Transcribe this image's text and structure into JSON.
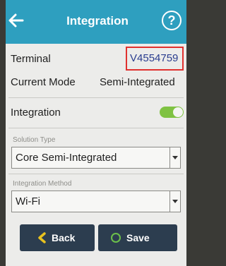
{
  "header": {
    "title": "Integration",
    "back_icon": "arrow-left-icon",
    "help_label": "?"
  },
  "info": {
    "terminal_label": "Terminal",
    "terminal_value": "V4554759",
    "mode_label": "Current Mode",
    "mode_value": "Semi-Integrated",
    "integration_label": "Integration",
    "integration_enabled": true
  },
  "form": {
    "solution_type_label": "Solution Type",
    "solution_type_value": "Core Semi-Integrated",
    "integration_method_label": "Integration Method",
    "integration_method_value": "Wi-Fi"
  },
  "actions": {
    "back_label": "Back",
    "save_label": "Save",
    "back_icon": "chevron-left-icon",
    "save_icon": "circle-icon"
  },
  "colors": {
    "header": "#2e9fbf",
    "toggle_on": "#7fc242",
    "button_bg": "#2c3d4f",
    "highlight": "#e0312f",
    "back_icon": "#e8c21f",
    "save_icon": "#6cc04a"
  }
}
